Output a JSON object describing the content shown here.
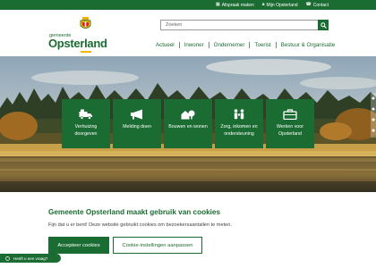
{
  "topbar": {
    "links": [
      {
        "icon": "calendar-icon",
        "label": "Afspraak maken"
      },
      {
        "icon": "lock-icon",
        "label": "Mijn Opsterland"
      },
      {
        "icon": "phone-icon",
        "label": "Contact"
      }
    ]
  },
  "logo": {
    "prefix": "gemeente",
    "name": "Opsterland"
  },
  "search": {
    "placeholder": "Zoeken"
  },
  "nav": {
    "items": [
      "Actueel",
      "Inwoner",
      "Ondernemer",
      "Toerist",
      "Bestuur & Organisatie"
    ]
  },
  "tiles": [
    {
      "icon": "moving-truck-icon",
      "label": "Verhuizing doorgeven"
    },
    {
      "icon": "megaphone-icon",
      "label": "Melding doen"
    },
    {
      "icon": "houses-icon",
      "label": "Bouwen en wonen"
    },
    {
      "icon": "family-icon",
      "label": "Zorg, inkomen en ondersteuning"
    },
    {
      "icon": "briefcase-icon",
      "label": "Werken voor Opsterland"
    }
  ],
  "cookie": {
    "title": "Gemeente Opsterland maakt gebruik van cookies",
    "text": "Fijn dat u er bent! Deze website gebruikt cookies om bezoekersaantallen te meten.",
    "accept_label": "Accepteer cookies",
    "settings_label": "Cookie-instellingen aanpassen"
  },
  "question_label": "Heeft u een vraag?",
  "colors": {
    "brand": "#1b6c32",
    "accent": "#f2b400"
  }
}
